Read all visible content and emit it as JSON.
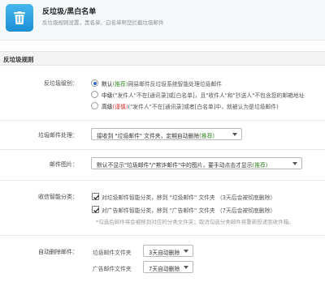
{
  "header": {
    "title": "反垃圾/黑白名单",
    "subtitle": "反垃圾规则设置，黑名单、白名单帮您拦截垃圾邮件"
  },
  "section": {
    "title": "反垃圾规则"
  },
  "level": {
    "label": "反垃圾级别：",
    "options": [
      {
        "name": "默认",
        "tag": "(推荐)",
        "desc": "网易邮件反垃圾系统智能处理垃圾邮件",
        "selected": true
      },
      {
        "name": "中级",
        "tag": "",
        "desc": "(\"发件人\"不在[通讯录]或[白名单]，且\"收件人\"和\"抄送人\"不包含您的邮箱地址",
        "selected": false
      },
      {
        "name": "高级",
        "tag": "(谨慎)",
        "desc": "(\"发件人\"不在[通讯录]或者[白名单]中，就被认为是垃圾邮件)",
        "selected": false
      }
    ]
  },
  "spam_handling": {
    "label": "垃圾邮件处理：",
    "value": "接收到 \"垃圾邮件\" 文件夹，定期自动删除",
    "tag": "(推荐)"
  },
  "images": {
    "label": "邮件图片：",
    "value": "默认不显示\"垃圾邮件\"/\"欺诈邮件\"中的图片，要手动点击才显示",
    "tag": "(推荐)"
  },
  "smart_classify": {
    "label": "收信智能分类：",
    "items": [
      {
        "text": "对垃圾邮件智能分类，移到 \"垃圾邮件\" 文件夹 （3天后会被彻底删除）",
        "checked": true
      },
      {
        "text": "对广告邮件智能分类，移到 \"广告邮件\" 文件夹 （7天后会被彻底删除）",
        "checked": true
      }
    ],
    "hint": "*勾选后邮件将会被移到对应的分类文件夹；取消勾选分类邮件将重新投递到收件箱。"
  },
  "auto_delete": {
    "label": "自动删除邮件：",
    "rows": [
      {
        "folder": "垃圾邮件文件夹",
        "value": "3天自动删除"
      },
      {
        "folder": "广告邮件文件夹",
        "value": "7天自动删除"
      }
    ]
  },
  "colors": {
    "accent": "#2d6ec7",
    "recommend": "#3a8a2a",
    "caution": "#d33333"
  },
  "icons": {
    "app": "trash-bin-icon",
    "dropdown": "chevron-down-icon",
    "check": "check-icon"
  }
}
